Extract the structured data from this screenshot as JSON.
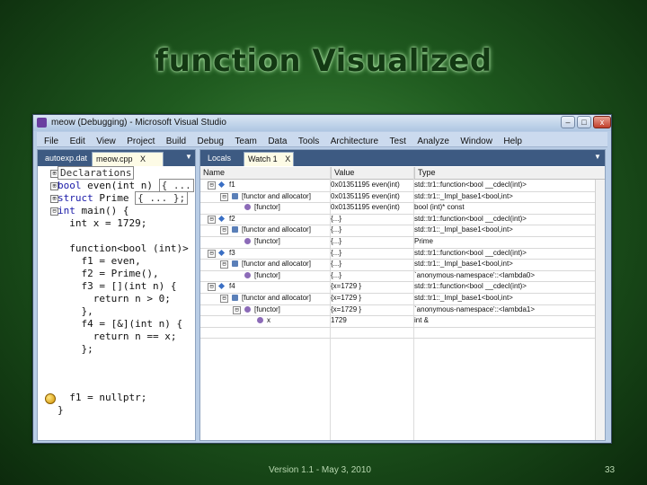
{
  "slide": {
    "title": "function Visualized",
    "footer": "Version 1.1 - May 3, 2010",
    "page_number": "33"
  },
  "window": {
    "title": "meow (Debugging) - Microsoft Visual Studio",
    "min_glyph": "–",
    "max_glyph": "□",
    "close_glyph": "x"
  },
  "menu": [
    "File",
    "Edit",
    "View",
    "Project",
    "Build",
    "Debug",
    "Team",
    "Data",
    "Tools",
    "Architecture",
    "Test",
    "Analyze",
    "Window",
    "Help"
  ],
  "editor": {
    "tabs": [
      {
        "label": "autoexp.dat",
        "active": false
      },
      {
        "label": "meow.cpp",
        "active": true,
        "close": "X"
      }
    ],
    "dropdown_glyph": "▼",
    "lines": {
      "l1_text": "Declarations",
      "l2_a": "bool",
      "l2_b": " even(int n)",
      "l2_box": "{ ...",
      "l3_a": "struct",
      "l3_b": " Prime",
      "l3_box": "{ ... };",
      "l4_a": "int",
      "l4_b": " main() {",
      "l5": "  int x = 1729;",
      "l6": "  function<bool (int)>",
      "l7": "    f1 = even,",
      "l8": "    f2 = Prime(),",
      "l9": "    f3 = [](int n) {",
      "l10": "      return n > 0;",
      "l11": "    },",
      "l12": "    f4 = [&](int n) {",
      "l13": "      return n == x;",
      "l14": "    };",
      "l15": "  f1 = nullptr;",
      "l16": "}"
    },
    "toggles": {
      "plus": "⊞",
      "minus": "⊟"
    }
  },
  "watch": {
    "tabs": [
      {
        "label": "Locals",
        "active": false
      },
      {
        "label": "Watch 1",
        "active": true,
        "close": "X"
      }
    ],
    "dropdown_glyph": "▼",
    "columns": {
      "name": "Name",
      "value": "Value",
      "type": "Type"
    },
    "rows": [
      {
        "indent": 0,
        "toggle": "⊟",
        "icon": "diamond",
        "name": "f1",
        "value": "0x01351195 even(int)",
        "type": "std::tr1::function<bool __cdecl(int)>"
      },
      {
        "indent": 1,
        "toggle": "⊟",
        "icon": "member",
        "name": "[functor and allocator]",
        "value": "0x01351195 even(int)",
        "type": "std::tr1::_Impl_base1<bool,int>"
      },
      {
        "indent": 2,
        "toggle": "",
        "icon": "wrench",
        "name": "[functor]",
        "value": "0x01351195 even(int)",
        "type": "bool (int)* const"
      },
      {
        "indent": 0,
        "toggle": "⊟",
        "icon": "diamond",
        "name": "f2",
        "value": "{...}",
        "type": "std::tr1::function<bool __cdecl(int)>"
      },
      {
        "indent": 1,
        "toggle": "⊟",
        "icon": "member",
        "name": "[functor and allocator]",
        "value": "{...}",
        "type": "std::tr1::_Impl_base1<bool,int>"
      },
      {
        "indent": 2,
        "toggle": "",
        "icon": "wrench",
        "name": "[functor]",
        "value": "{...}",
        "type": "Prime"
      },
      {
        "indent": 0,
        "toggle": "⊟",
        "icon": "diamond",
        "name": "f3",
        "value": "{...}",
        "type": "std::tr1::function<bool __cdecl(int)>"
      },
      {
        "indent": 1,
        "toggle": "⊟",
        "icon": "member",
        "name": "[functor and allocator]",
        "value": "{...}",
        "type": "std::tr1::_Impl_base1<bool,int>"
      },
      {
        "indent": 2,
        "toggle": "",
        "icon": "wrench",
        "name": "[functor]",
        "value": "{...}",
        "type": "`anonymous-namespace'::<lambda0>"
      },
      {
        "indent": 0,
        "toggle": "⊟",
        "icon": "diamond",
        "name": "f4",
        "value": "{x=1729 }",
        "type": "std::tr1::function<bool __cdecl(int)>"
      },
      {
        "indent": 1,
        "toggle": "⊟",
        "icon": "member",
        "name": "[functor and allocator]",
        "value": "{x=1729 }",
        "type": "std::tr1::_Impl_base1<bool,int>"
      },
      {
        "indent": 2,
        "toggle": "⊟",
        "icon": "wrench",
        "name": "[functor]",
        "value": "{x=1729 }",
        "type": "`anonymous-namespace'::<lambda1>"
      },
      {
        "indent": 3,
        "toggle": "",
        "icon": "wrench",
        "name": "x",
        "value": "1729",
        "type": "int &"
      },
      {
        "indent": 0,
        "toggle": "",
        "icon": "",
        "name": "",
        "value": "",
        "type": ""
      }
    ]
  }
}
